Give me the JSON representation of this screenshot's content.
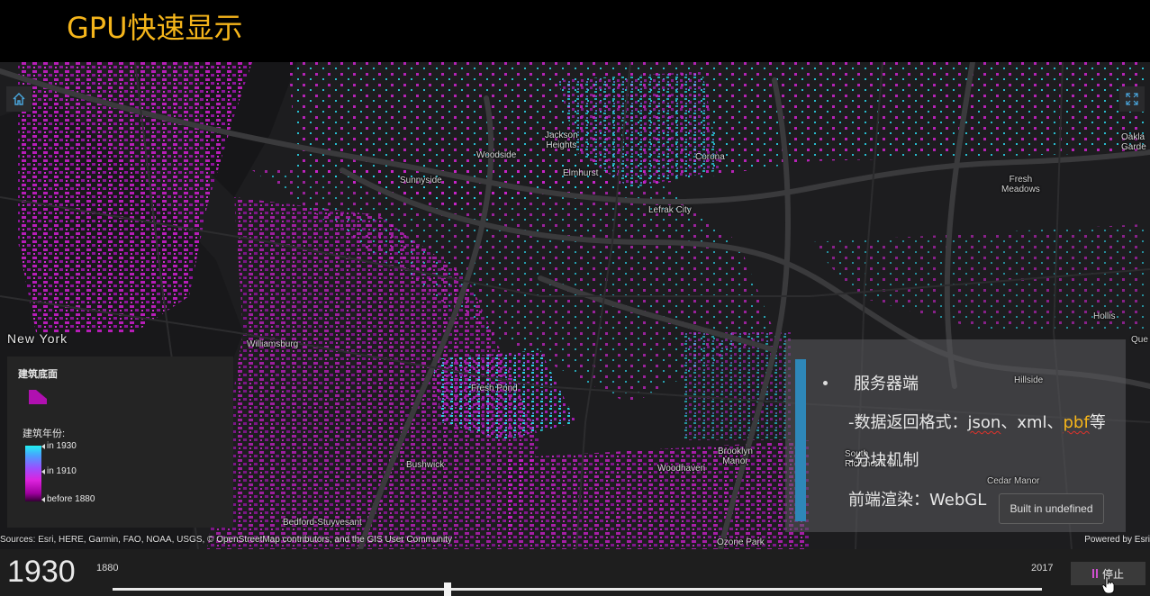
{
  "slide_title": "GPU快速显示",
  "map": {
    "places": [
      {
        "name": "Jackson\nHeights"
      },
      {
        "name": "Corona"
      },
      {
        "name": "Woodside"
      },
      {
        "name": "Elmhurst"
      },
      {
        "name": "Sunnyside"
      },
      {
        "name": "Lefrak City"
      },
      {
        "name": "Fresh\nMeadows"
      },
      {
        "name": "Oakla\nGarde"
      },
      {
        "name": "Hollis"
      },
      {
        "name": "Que"
      },
      {
        "name": "New York"
      },
      {
        "name": "Williamsburg"
      },
      {
        "name": "Fresh Pond"
      },
      {
        "name": "Bushwick"
      },
      {
        "name": "Brooklyn\nManor"
      },
      {
        "name": "Woodhaven"
      },
      {
        "name": "Bedford-Stuyvesant"
      },
      {
        "name": "Ozone Park"
      },
      {
        "name": "Hillside"
      },
      {
        "name": "South\nRichmond Hill"
      },
      {
        "name": "Cedar Manor"
      }
    ],
    "home_icon": "home-icon",
    "fullscreen_icon": "expand-icon"
  },
  "legend": {
    "layer_title": "建筑底面",
    "field_title": "建筑年份:",
    "stops": [
      "in 1930",
      "in 1910",
      "before 1880"
    ],
    "colors": {
      "top": "#22f0f0",
      "mid": "#9a50ff",
      "bottom": "#a000a0"
    }
  },
  "overlay": {
    "line1": "服务器端",
    "line2_prefix": "-数据返回格式：",
    "fmt_json": "json",
    "sep1": "、",
    "fmt_xml": "xml",
    "sep2": "、",
    "fmt_pbf": "pbf",
    "line2_suffix": "等",
    "line3": "-分块机制",
    "line4": "前端渲染：WebGL",
    "accent": "#2e87b8"
  },
  "built_tooltip": "Built in undefined",
  "attribution": "Sources: Esri, HERE, Garmin, FAO, NOAA, USGS, © OpenStreetMap contributors, and the GIS User Community",
  "powered_by": "Powered by Esri",
  "time_slider": {
    "current_year": "1930",
    "min_label": "1880",
    "max_label": "2017",
    "value_fraction": 0.36,
    "stop_label": "停止"
  }
}
